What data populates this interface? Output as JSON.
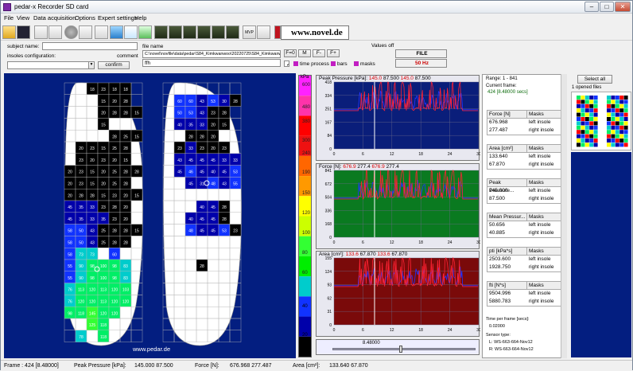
{
  "window": {
    "title": "pedar-x Recorder SD card",
    "min": "–",
    "max": "□",
    "close": "✕"
  },
  "menu": [
    "File",
    "View",
    "Data acquisition",
    "Options",
    "Expert settings",
    "Help"
  ],
  "toolbar": {
    "mvp": "MVP",
    "link_text": "www.novel.de"
  },
  "info": {
    "subject_label": "subject name:",
    "subject_value": "",
    "file_label": "file name",
    "file_value": "C:\\novel\\novfile\\data\\pedar\\S84_Kimkwanwoo\\20220725\\S84_Kimkwanwoo_1.sol",
    "comment_label": "comment",
    "comment_value": "ffh",
    "values_label": "Values off",
    "values_btns": [
      "F=0",
      "M",
      "F-",
      "F+"
    ],
    "file_box": "FILE",
    "rate": "50 Hz",
    "insoles_label": "insoles configuration:",
    "insoles_value": "",
    "confirm": "confirm",
    "options": [
      "time process",
      "bars",
      "masks"
    ]
  },
  "scale": {
    "unit": "kPa",
    "ticks": [
      "600",
      "480",
      "380",
      "300",
      "240",
      "190",
      "150",
      "120",
      "100",
      "80",
      "60",
      "40",
      "20",
      "15"
    ],
    "colors": [
      "#ff22ff",
      "#ff33aa",
      "#ff0000",
      "#ee1111",
      "#ff6600",
      "#ff9900",
      "#ffff00",
      "#ccff00",
      "#33ff33",
      "#00ee00",
      "#00cccc",
      "#1133ff",
      "#0000aa",
      "#000000"
    ]
  },
  "left_foot": [
    [
      null,
      null,
      18,
      23,
      18,
      18,
      null
    ],
    [
      null,
      null,
      null,
      15,
      20,
      28,
      null
    ],
    [
      null,
      null,
      null,
      20,
      28,
      28,
      15
    ],
    [
      null,
      null,
      null,
      15,
      null,
      null,
      null
    ],
    [
      null,
      null,
      null,
      null,
      28,
      25,
      15
    ],
    [
      null,
      20,
      23,
      15,
      25,
      28,
      null
    ],
    [
      null,
      23,
      20,
      23,
      20,
      15,
      null
    ],
    [
      20,
      23,
      15,
      20,
      25,
      28,
      28
    ],
    [
      20,
      23,
      15,
      20,
      25,
      28,
      null
    ],
    [
      20,
      28,
      28,
      15,
      23,
      20,
      15
    ],
    [
      45,
      35,
      33,
      23,
      28,
      20,
      null
    ],
    [
      45,
      35,
      33,
      35,
      23,
      20,
      null
    ],
    [
      58,
      50,
      43,
      25,
      28,
      28,
      15
    ],
    [
      58,
      50,
      43,
      25,
      28,
      28,
      null
    ],
    [
      58,
      73,
      73,
      null,
      60,
      null,
      null
    ],
    [
      55,
      90,
      98,
      100,
      98,
      83,
      null
    ],
    [
      55,
      90,
      98,
      100,
      98,
      83,
      null
    ],
    [
      76,
      113,
      120,
      113,
      120,
      103,
      null
    ],
    [
      76,
      120,
      120,
      113,
      120,
      120,
      null
    ],
    [
      98,
      118,
      145,
      120,
      120,
      null,
      null
    ],
    [
      null,
      null,
      125,
      118,
      null,
      null,
      null
    ],
    [
      null,
      78,
      null,
      118,
      null,
      null,
      null
    ]
  ],
  "right_foot": [
    [
      null,
      null,
      null,
      null,
      null,
      null,
      null
    ],
    [
      null,
      60,
      null,
      43,
      null,
      null,
      null
    ],
    [
      null,
      50,
      null,
      null,
      null,
      28,
      null
    ],
    [
      null,
      40,
      33,
      null,
      null,
      null,
      null
    ],
    [
      null,
      null,
      null,
      null,
      null,
      null,
      null
    ],
    [
      null,
      23,
      null,
      null,
      null,
      null,
      null
    ],
    [
      null,
      null,
      null,
      null,
      null,
      null,
      null
    ],
    [
      null,
      null,
      null,
      null,
      null,
      null,
      null
    ],
    [
      null,
      null,
      null,
      null,
      null,
      null,
      null
    ],
    [
      null,
      null,
      null,
      null,
      null,
      null,
      null
    ],
    [
      null,
      null,
      null,
      null,
      null,
      null,
      null
    ],
    [
      null,
      null,
      null,
      null,
      null,
      null,
      null
    ],
    [
      null,
      null,
      null,
      null,
      null,
      null,
      null
    ],
    [
      null,
      null,
      null,
      null,
      null,
      null,
      null
    ],
    [
      null,
      null,
      null,
      null,
      null,
      null,
      null
    ],
    [
      null,
      null,
      null,
      null,
      null,
      null,
      null
    ],
    [
      null,
      null,
      null,
      null,
      null,
      null,
      null
    ],
    [
      null,
      null,
      null,
      null,
      null,
      null,
      null
    ],
    [
      null,
      null,
      null,
      null,
      null,
      null,
      null
    ],
    [
      null,
      null,
      null,
      null,
      null,
      null,
      null
    ],
    [
      null,
      null,
      null,
      null,
      null,
      null,
      null
    ],
    [
      null,
      null,
      null,
      null,
      null,
      null,
      null
    ]
  ],
  "right_foot_labels": [
    {
      "row": 1,
      "col": 1,
      "t": "60"
    },
    {
      "row": 1,
      "col": 2,
      "t": "60"
    },
    {
      "row": 1,
      "col": 3,
      "t": "43"
    },
    {
      "row": 1,
      "col": 4,
      "t": "53"
    },
    {
      "row": 1,
      "col": 5,
      "t": "30"
    },
    {
      "row": 1,
      "col": 6,
      "t": "28"
    },
    {
      "row": 2,
      "col": 1,
      "t": "50"
    },
    {
      "row": 2,
      "col": 2,
      "t": "53"
    },
    {
      "row": 2,
      "col": 3,
      "t": "43"
    },
    {
      "row": 2,
      "col": 4,
      "t": "23"
    },
    {
      "row": 2,
      "col": 5,
      "t": "28"
    },
    {
      "row": 3,
      "col": 1,
      "t": "40"
    },
    {
      "row": 3,
      "col": 2,
      "t": "35"
    },
    {
      "row": 3,
      "col": 3,
      "t": "33"
    },
    {
      "row": 3,
      "col": 4,
      "t": "20"
    },
    {
      "row": 3,
      "col": 5,
      "t": "15"
    },
    {
      "row": 4,
      "col": 2,
      "t": "28"
    },
    {
      "row": 4,
      "col": 3,
      "t": "28"
    },
    {
      "row": 4,
      "col": 4,
      "t": "20"
    },
    {
      "row": 5,
      "col": 1,
      "t": "23"
    },
    {
      "row": 5,
      "col": 2,
      "t": "33"
    },
    {
      "row": 5,
      "col": 3,
      "t": "23"
    },
    {
      "row": 5,
      "col": 4,
      "t": "20"
    },
    {
      "row": 5,
      "col": 5,
      "t": "23"
    },
    {
      "row": 6,
      "col": 1,
      "t": "43"
    },
    {
      "row": 6,
      "col": 2,
      "t": "45"
    },
    {
      "row": 6,
      "col": 3,
      "t": "45"
    },
    {
      "row": 6,
      "col": 4,
      "t": "45"
    },
    {
      "row": 6,
      "col": 5,
      "t": "33"
    },
    {
      "row": 6,
      "col": 6,
      "t": "33"
    },
    {
      "row": 7,
      "col": 1,
      "t": "45"
    },
    {
      "row": 7,
      "col": 2,
      "t": "46"
    },
    {
      "row": 7,
      "col": 3,
      "t": "45"
    },
    {
      "row": 7,
      "col": 4,
      "t": "40"
    },
    {
      "row": 7,
      "col": 5,
      "t": "45"
    },
    {
      "row": 7,
      "col": 6,
      "t": "53"
    },
    {
      "row": 8,
      "col": 2,
      "t": "45"
    },
    {
      "row": 8,
      "col": 3,
      "t": "31"
    },
    {
      "row": 8,
      "col": 4,
      "t": "48"
    },
    {
      "row": 8,
      "col": 5,
      "t": "43"
    },
    {
      "row": 8,
      "col": 6,
      "t": "55"
    },
    {
      "row": 10,
      "col": 3,
      "t": "40"
    },
    {
      "row": 10,
      "col": 4,
      "t": "45"
    },
    {
      "row": 10,
      "col": 5,
      "t": "28"
    },
    {
      "row": 11,
      "col": 2,
      "t": "40"
    },
    {
      "row": 11,
      "col": 3,
      "t": "45"
    },
    {
      "row": 11,
      "col": 4,
      "t": "45"
    },
    {
      "row": 11,
      "col": 5,
      "t": "28"
    },
    {
      "row": 12,
      "col": 2,
      "t": "48"
    },
    {
      "row": 12,
      "col": 3,
      "t": "45"
    },
    {
      "row": 12,
      "col": 4,
      "t": "45"
    },
    {
      "row": 12,
      "col": 5,
      "t": "53"
    },
    {
      "row": 12,
      "col": 6,
      "t": "23"
    },
    {
      "row": 15,
      "col": 3,
      "t": "28"
    }
  ],
  "foot_caption": "www.pedar.de",
  "graphs": [
    {
      "title": "Peak Pressure  [kPa]:",
      "v1": "145.0",
      "v2": "87.500",
      "v3": "145.0",
      "v4": "87.500",
      "yticks": [
        "418",
        "334",
        "251",
        "167",
        "84",
        "0"
      ],
      "bg": "#0a1e7a"
    },
    {
      "title": "Force [N]:",
      "v1": "676.9",
      "v2": "277.4",
      "v3": "676.9",
      "v4": "277.4",
      "yticks": [
        "841",
        "672",
        "504",
        "336",
        "168",
        "0"
      ],
      "bg": "#0a7a20"
    },
    {
      "title": "Area [cm²]:",
      "v1": "133.6",
      "v2": "67.870",
      "v3": "133.6",
      "v4": "67.870",
      "yticks": [
        "155",
        "124",
        "93",
        "62",
        "31",
        "0"
      ],
      "bg": "#7a0a0a"
    }
  ],
  "xticks": [
    "0",
    "6",
    "12",
    "18",
    "24",
    "30"
  ],
  "slider_value": "8.48000",
  "side": {
    "range": "Range: 1 - 841",
    "current_frame_label": "Current frame:",
    "current_frame": "424 [8.48000 secs]",
    "blocks": [
      {
        "h": "Force [N]",
        "v": [
          [
            "676.968",
            "left insole"
          ],
          [
            "277.487",
            "right insole"
          ]
        ]
      },
      {
        "h": "Area [cm²]",
        "v": [
          [
            "133.640",
            "left insole"
          ],
          [
            "67.870",
            "right insole"
          ]
        ]
      },
      {
        "h": "Peak Pressure...",
        "v": [
          [
            "145.000",
            "left insole"
          ],
          [
            "87.500",
            "right insole"
          ]
        ]
      },
      {
        "h": "Mean Pressur...",
        "v": [
          [
            "50.656",
            "left insole"
          ],
          [
            "40.885",
            "right insole"
          ]
        ]
      },
      {
        "h": "pti [kPa*s]",
        "v": [
          [
            "2503.600",
            "left insole"
          ],
          [
            "1928.750",
            "right insole"
          ]
        ]
      },
      {
        "h": "fti [N*s]",
        "v": [
          [
            "9504.996",
            "left insole"
          ],
          [
            "5880.783",
            "right insole"
          ]
        ]
      }
    ],
    "masks_label": "Masks",
    "time_label": "Time per frame [secs]:",
    "time_value": "0.02000",
    "sensor_label": "Sensor type:",
    "sensor_l": "L: WS-663-664-Nov12",
    "sensor_r": "R: WS-663-664-Nov12"
  },
  "right": {
    "select_all": "Select all",
    "opened": "1 opened files"
  },
  "status": {
    "frame": "Frame : 424 [8.48000]",
    "pp_label": "Peak Pressure  [kPa]:",
    "pp_val": "145.000  87.500",
    "f_label": "Force [N]:",
    "f_val": "676.968  277.487",
    "a_label": "Area [cm²]:",
    "a_val": "133.640  67.870"
  }
}
